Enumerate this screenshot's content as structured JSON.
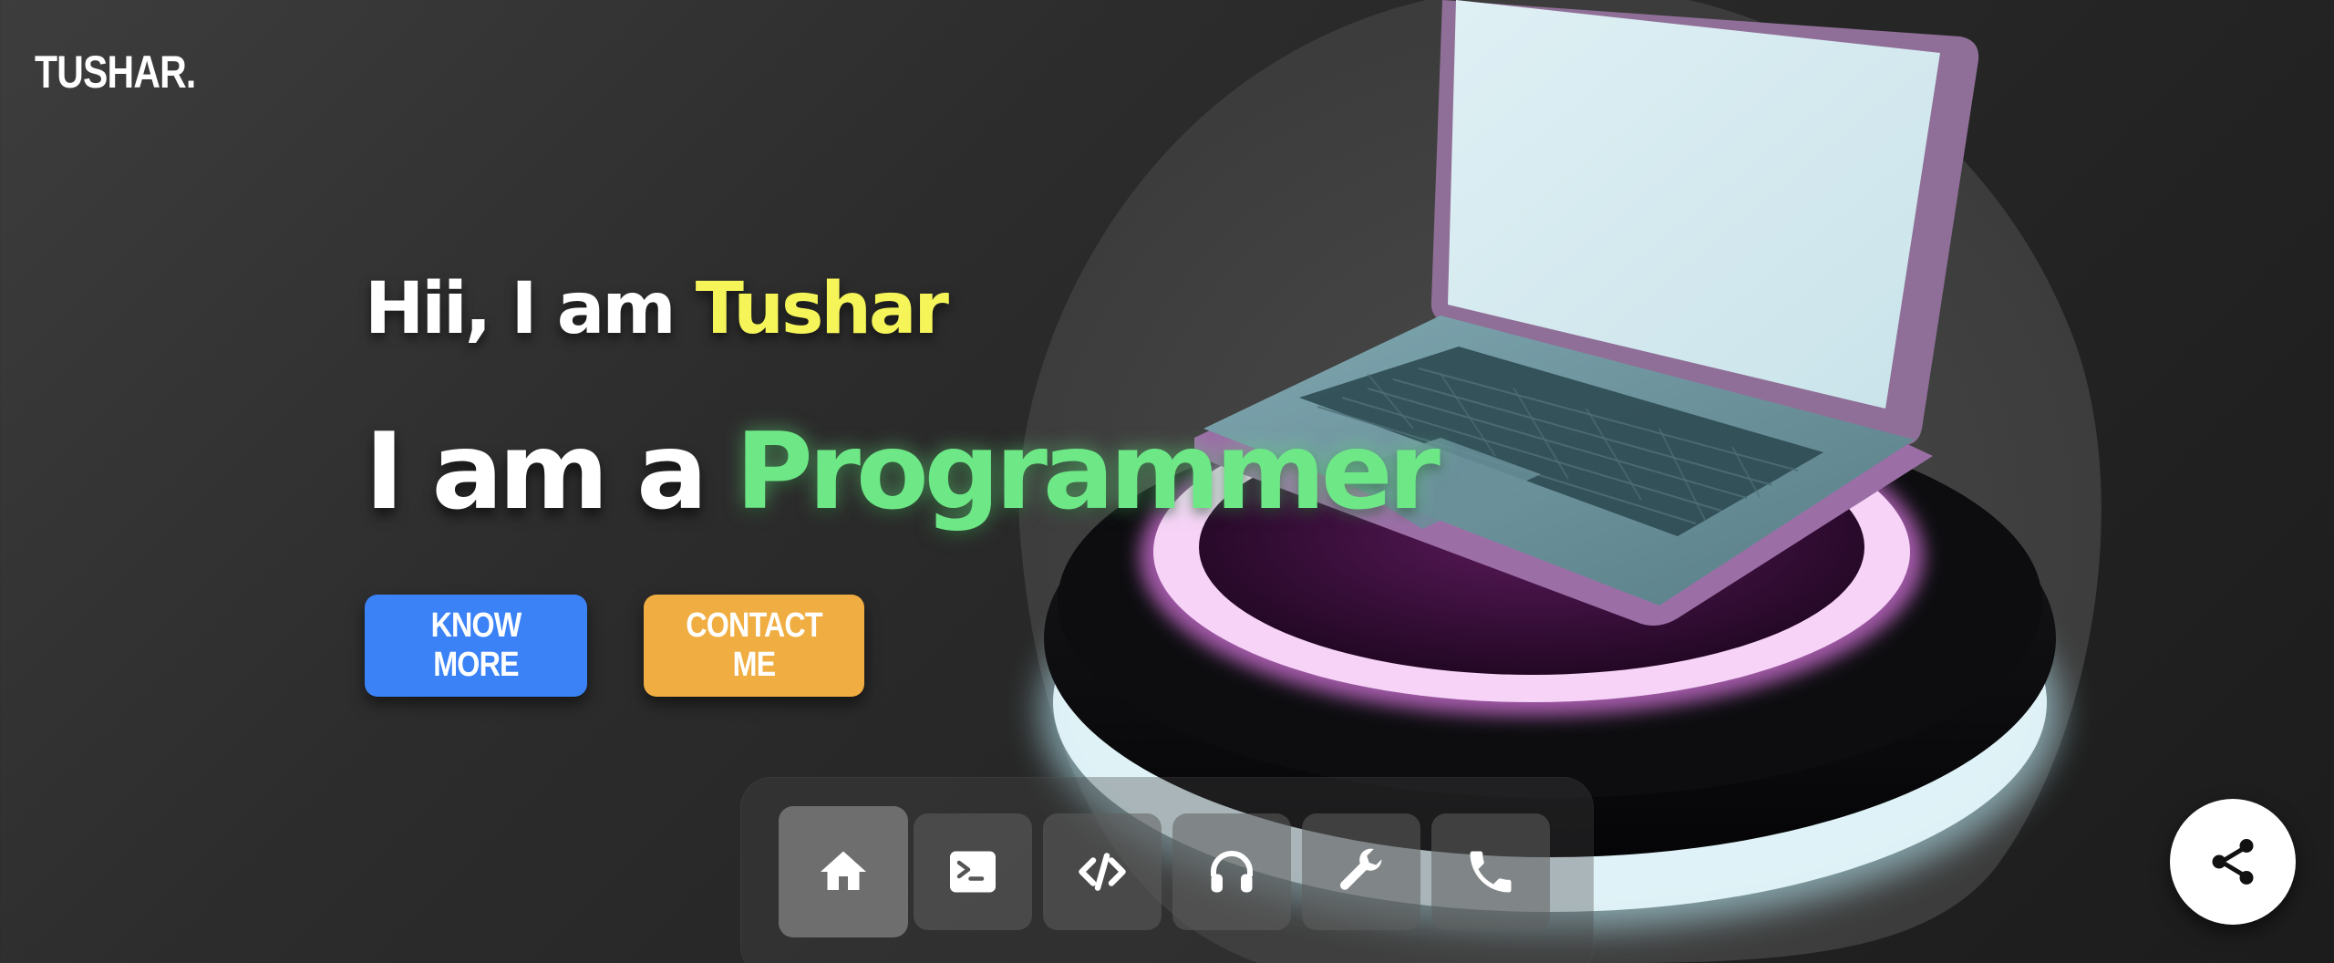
{
  "brand": {
    "logo_text": "TUSHAR."
  },
  "hero": {
    "greeting_prefix": "Hii, I am ",
    "name": "Tushar",
    "role_prefix": "I am a ",
    "role": "Programmer",
    "name_color": "#f5f55a",
    "role_color": "#6ee887"
  },
  "buttons": {
    "know_more": "KNOW MORE",
    "contact_me": "CONTACT ME",
    "know_more_color": "#3b82f6",
    "contact_me_color": "#f0ad41"
  },
  "dock": {
    "items": [
      {
        "icon": "home-icon",
        "active": true
      },
      {
        "icon": "terminal-icon",
        "active": false
      },
      {
        "icon": "code-icon",
        "active": false
      },
      {
        "icon": "headphones-icon",
        "active": false
      },
      {
        "icon": "wrench-icon",
        "active": false
      },
      {
        "icon": "phone-icon",
        "active": false
      }
    ]
  },
  "share": {
    "icon": "share-icon"
  }
}
